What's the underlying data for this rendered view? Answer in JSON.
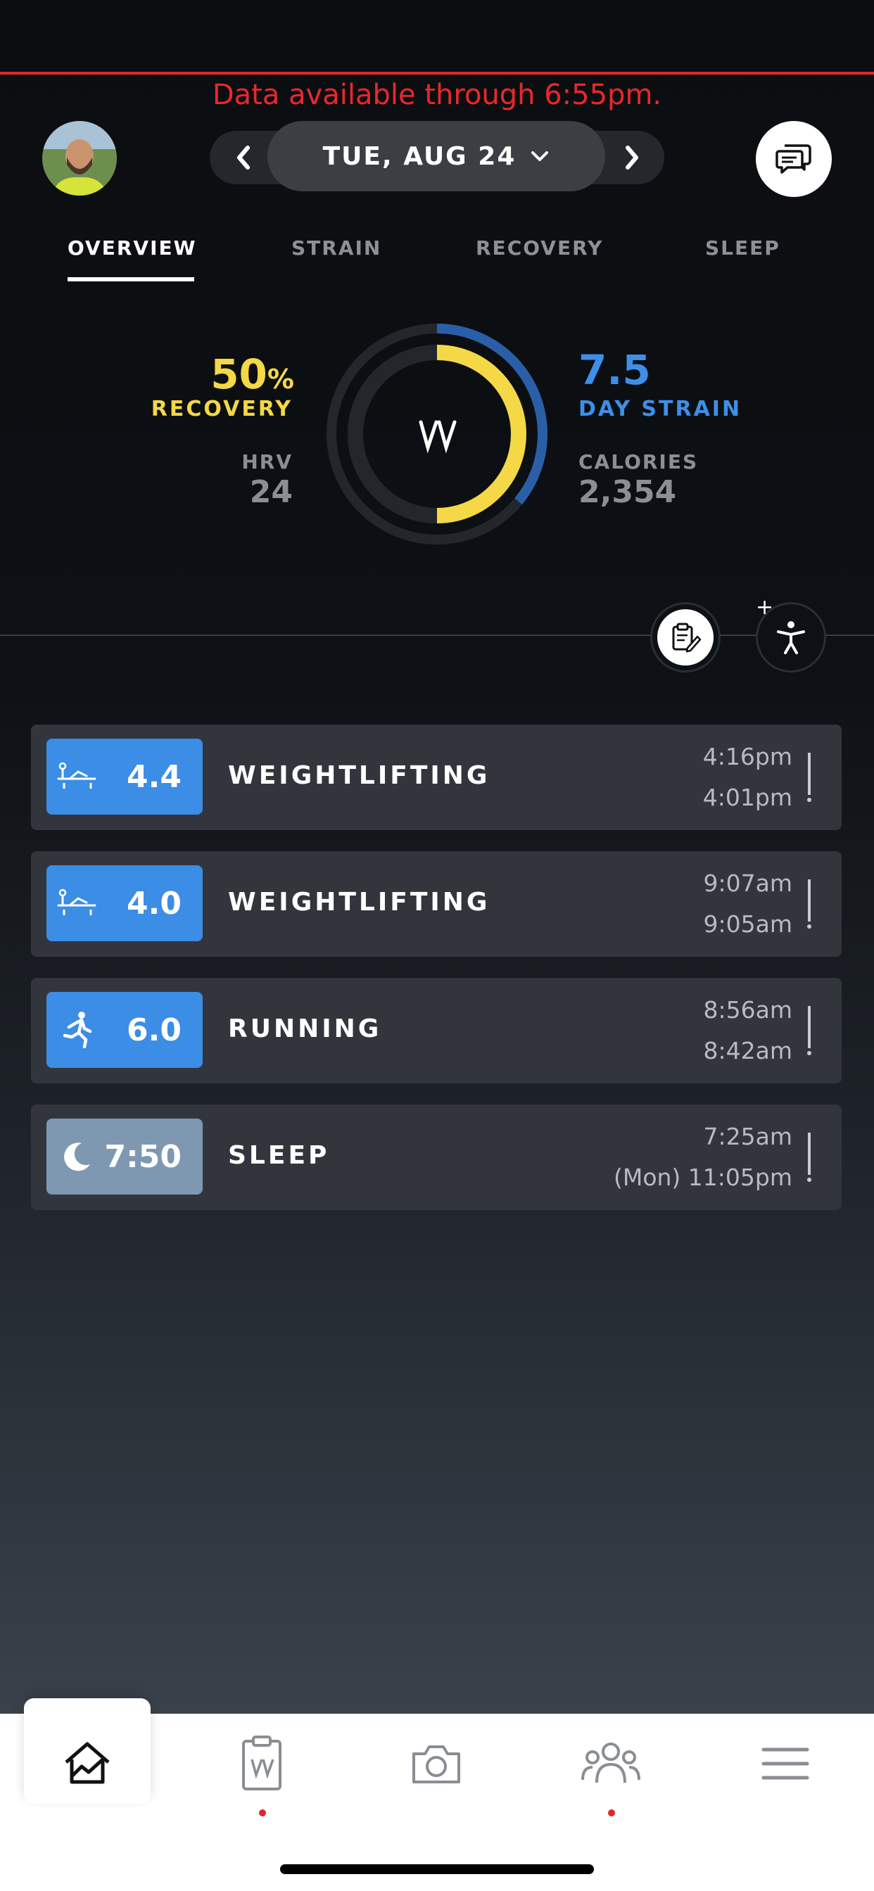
{
  "banner": {
    "text": "Data available through 6:55pm."
  },
  "header": {
    "date_label": "TUE, AUG 24"
  },
  "tabs": [
    {
      "label": "OVERVIEW",
      "active": true
    },
    {
      "label": "STRAIN",
      "active": false
    },
    {
      "label": "RECOVERY",
      "active": false
    },
    {
      "label": "SLEEP",
      "active": false
    }
  ],
  "summary": {
    "recovery_value": "50",
    "recovery_unit": "%",
    "recovery_label": "RECOVERY",
    "hrv_label": "HRV",
    "hrv_value": "24",
    "strain_value": "7.5",
    "strain_label": "DAY STRAIN",
    "calories_label": "CALORIES",
    "calories_value": "2,354",
    "recovery_fraction": 0.5,
    "strain_fraction": 0.36,
    "ring_center_logo": "W"
  },
  "colors": {
    "recovery": "#f4d845",
    "strain": "#2a5fa8",
    "activity_badge": "#3b8de6",
    "sleep_badge": "#7e98b2",
    "banner": "#e8282d"
  },
  "activities": [
    {
      "icon": "weightlifting-icon",
      "score": "4.4",
      "name": "WEIGHTLIFTING",
      "end": "4:16pm",
      "start": "4:01pm"
    },
    {
      "icon": "weightlifting-icon",
      "score": "4.0",
      "name": "WEIGHTLIFTING",
      "end": "9:07am",
      "start": "9:05am"
    },
    {
      "icon": "running-icon",
      "score": "6.0",
      "name": "RUNNING",
      "end": "8:56am",
      "start": "8:42am"
    },
    {
      "icon": "moon-icon",
      "score": "7:50",
      "name": "SLEEP",
      "end": "7:25am",
      "start": "(Mon) 11:05pm"
    }
  ],
  "bottom_nav": [
    {
      "icon": "home-chart-icon",
      "active": true
    },
    {
      "icon": "journal-clipboard-icon",
      "notification": true
    },
    {
      "icon": "camera-icon"
    },
    {
      "icon": "community-icon",
      "notification": true
    },
    {
      "icon": "menu-icon"
    }
  ]
}
